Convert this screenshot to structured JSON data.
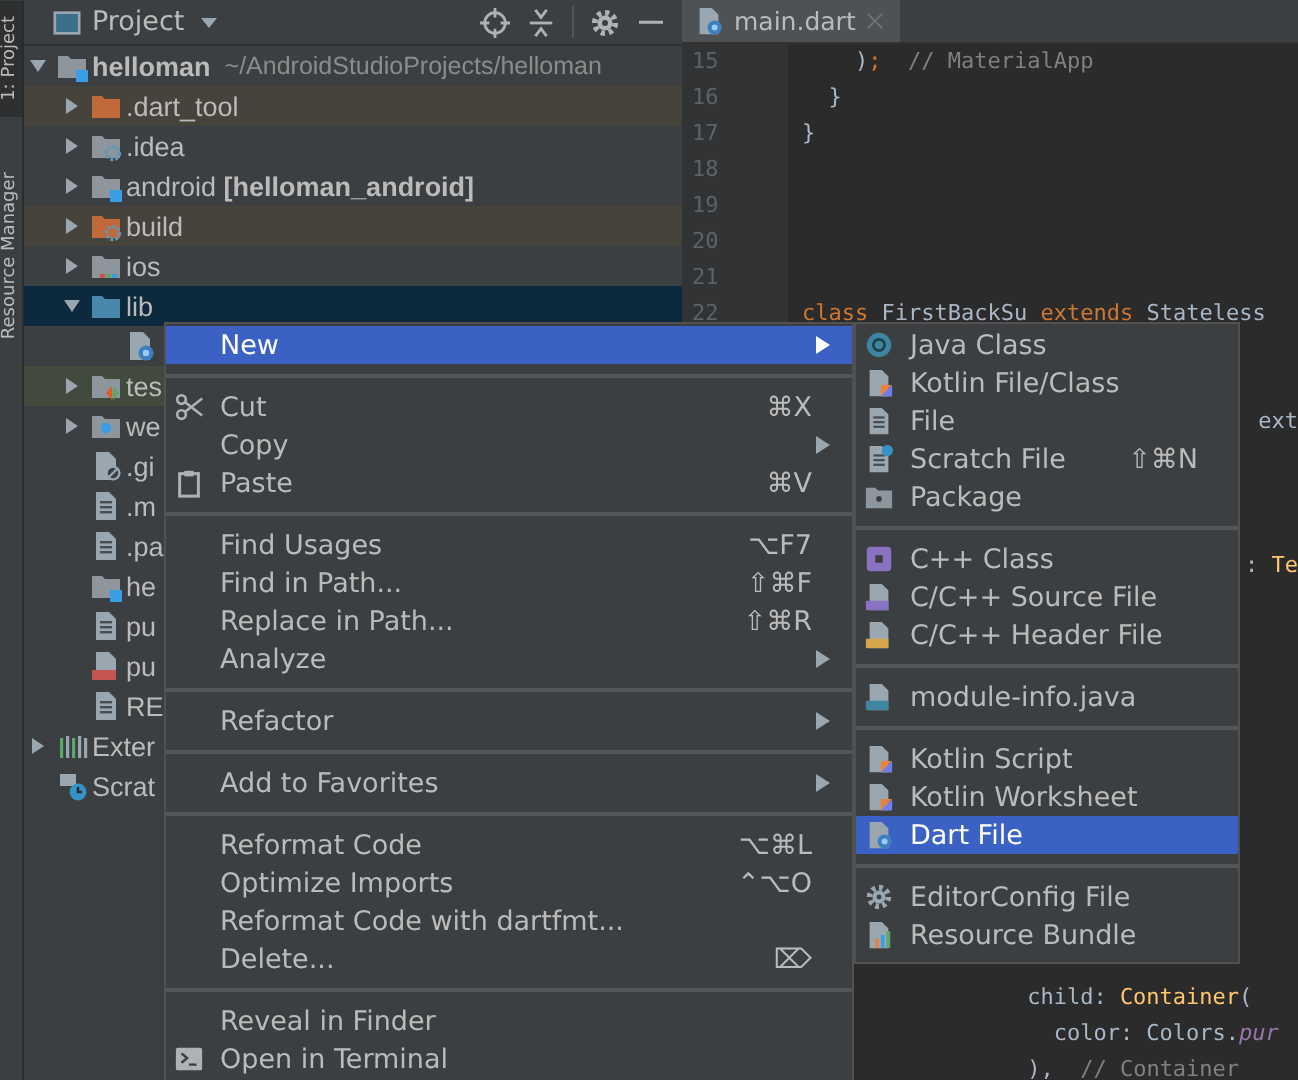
{
  "tool_stripe": {
    "tabs": [
      {
        "label": "1: Project",
        "selected": true
      },
      {
        "label": "Resource Manager",
        "selected": false
      }
    ]
  },
  "project_panel": {
    "title": "Project",
    "tree": [
      {
        "label": "helloman",
        "path": "~/AndroidStudioProjects/helloman",
        "kind": "module",
        "expanded": true,
        "selected": false,
        "children": [
          {
            "label": ".dart_tool",
            "kind": "excluded-folder",
            "expanded": false,
            "selected": false
          },
          {
            "label": ".idea",
            "kind": "config-folder",
            "expanded": false,
            "selected": false
          },
          {
            "label": "android **[helloman_android]**",
            "kind": "module-folder",
            "expanded": false,
            "selected": false
          },
          {
            "label": "build",
            "kind": "excluded-config-folder",
            "expanded": false,
            "selected": false
          },
          {
            "label": "ios",
            "kind": "ios-folder",
            "expanded": false,
            "selected": false
          },
          {
            "label": "lib",
            "kind": "source-folder",
            "expanded": true,
            "selected": true,
            "children": [
              {
                "kind": "dart-file",
                "selected": false
              }
            ]
          },
          {
            "label": "tes",
            "kind": "test-folder",
            "expanded": false,
            "selected": false
          },
          {
            "label": "we",
            "kind": "web-folder",
            "expanded": false,
            "selected": false
          },
          {
            "label": ".gi",
            "kind": "ignore-file",
            "selected": false
          },
          {
            "label": ".m",
            "kind": "text-file",
            "selected": false
          },
          {
            "label": ".pa",
            "kind": "text-file",
            "selected": false
          },
          {
            "label": "he",
            "kind": "module-file",
            "selected": false
          },
          {
            "label": "pu",
            "kind": "text-file",
            "selected": false
          },
          {
            "label": "pu",
            "kind": "yml-file",
            "selected": false
          },
          {
            "label": "RE",
            "kind": "text-file",
            "selected": false
          }
        ]
      },
      {
        "label": "Exter",
        "kind": "libraries",
        "expanded": false,
        "selected": false
      },
      {
        "label": "Scrat",
        "kind": "scratches",
        "selected": false
      }
    ]
  },
  "editor": {
    "tabs": [
      {
        "label": "main.dart",
        "selected": true
      }
    ],
    "lines": [
      {
        "number": "15",
        "tokens": [
          {
            "text": "    )",
            "kind": "plain"
          },
          {
            "text": ";",
            "kind": "keyword"
          },
          {
            "text": "  // MaterialApp",
            "kind": "comment"
          }
        ]
      },
      {
        "number": "16",
        "tokens": [
          {
            "text": "  }",
            "kind": "plain"
          }
        ]
      },
      {
        "number": "17",
        "tokens": [
          {
            "text": "}",
            "kind": "plain"
          }
        ]
      },
      {
        "number": "18"
      },
      {
        "number": "19"
      },
      {
        "number": "20"
      },
      {
        "number": "21"
      },
      {
        "number": "22",
        "tokens": [
          {
            "text": "class ",
            "kind": "keyword"
          },
          {
            "text": "FirstBackSu ",
            "kind": "plain"
          },
          {
            "text": "extends ",
            "kind": "keyword"
          },
          {
            "text": "Stateless",
            "kind": "plain"
          }
        ]
      }
    ],
    "fragments": [
      {
        "tokens": [
          {
            "text": "ext",
            "kind": "plain"
          }
        ]
      },
      {
        "tokens": [
          {
            "text": ": ",
            "kind": "plain"
          },
          {
            "text": "Te",
            "kind": "class"
          }
        ]
      },
      {
        "tokens": [
          {
            "text": "child: ",
            "kind": "plain"
          },
          {
            "text": "Container",
            "kind": "class"
          },
          {
            "text": "(",
            "kind": "plain"
          }
        ]
      },
      {
        "tokens": [
          {
            "text": "color: Colors.",
            "kind": "plain"
          },
          {
            "text": "pur",
            "kind": "field"
          }
        ]
      },
      {
        "tokens": [
          {
            "text": "),  ",
            "kind": "plain"
          },
          {
            "text": "// Container",
            "kind": "comment"
          }
        ]
      }
    ]
  },
  "context_menu": {
    "groups": [
      {
        "items": [
          {
            "label": "New",
            "submenu": true,
            "selected": true
          }
        ]
      },
      {
        "items": [
          {
            "label": "Cut",
            "kind": "cut",
            "shortcut": "⌘X",
            "submenu": false,
            "selected": false
          },
          {
            "label": "Copy",
            "submenu": true,
            "selected": false
          },
          {
            "label": "Paste",
            "kind": "paste",
            "shortcut": "⌘V",
            "submenu": false,
            "selected": false
          }
        ]
      },
      {
        "items": [
          {
            "label": "Find Usages",
            "shortcut": "⌥F7",
            "submenu": false,
            "selected": false
          },
          {
            "label": "Find in Path...",
            "shortcut": "⇧⌘F",
            "submenu": false,
            "selected": false
          },
          {
            "label": "Replace in Path...",
            "shortcut": "⇧⌘R",
            "submenu": false,
            "selected": false
          },
          {
            "label": "Analyze",
            "submenu": true,
            "selected": false
          }
        ]
      },
      {
        "items": [
          {
            "label": "Refactor",
            "submenu": true,
            "selected": false
          }
        ]
      },
      {
        "items": [
          {
            "label": "Add to Favorites",
            "submenu": true,
            "selected": false
          }
        ]
      },
      {
        "items": [
          {
            "label": "Reformat Code",
            "shortcut": "⌥⌘L",
            "submenu": false,
            "selected": false
          },
          {
            "label": "Optimize Imports",
            "shortcut": "⌃⌥O",
            "submenu": false,
            "selected": false
          },
          {
            "label": "Reformat Code with dartfmt...",
            "submenu": false,
            "selected": false
          },
          {
            "label": "Delete...",
            "shortcut": "⌦",
            "submenu": false,
            "selected": false
          }
        ]
      },
      {
        "items": [
          {
            "label": "Reveal in Finder",
            "submenu": false,
            "selected": false
          },
          {
            "label": "Open in Terminal",
            "kind": "terminal",
            "submenu": false,
            "selected": false
          }
        ]
      }
    ]
  },
  "new_submenu": {
    "groups": [
      {
        "items": [
          {
            "label": "Java Class",
            "kind": "java-class",
            "selected": false
          },
          {
            "label": "Kotlin File/Class",
            "kind": "kotlin-file",
            "selected": false
          },
          {
            "label": "File",
            "kind": "file",
            "selected": false
          },
          {
            "label": "Scratch File",
            "kind": "scratch",
            "shortcut": "⇧⌘N",
            "selected": false
          },
          {
            "label": "Package",
            "kind": "package",
            "selected": false
          }
        ]
      },
      {
        "items": [
          {
            "label": "C++ Class",
            "kind": "cpp-class",
            "selected": false
          },
          {
            "label": "C/C++ Source File",
            "kind": "c-source",
            "selected": false
          },
          {
            "label": "C/C++ Header File",
            "kind": "c-header",
            "selected": false
          }
        ]
      },
      {
        "items": [
          {
            "label": "module-info.java",
            "kind": "module-info",
            "selected": false
          }
        ]
      },
      {
        "items": [
          {
            "label": "Kotlin Script",
            "kind": "kotlin-file",
            "selected": false
          },
          {
            "label": "Kotlin Worksheet",
            "kind": "kotlin-file",
            "selected": false
          },
          {
            "label": "Dart File",
            "kind": "dart-file",
            "selected": true
          }
        ]
      },
      {
        "items": [
          {
            "label": "EditorConfig File",
            "kind": "editorconfig",
            "selected": false
          },
          {
            "label": "Resource Bundle",
            "kind": "resource-bundle",
            "selected": false
          }
        ]
      }
    ]
  }
}
